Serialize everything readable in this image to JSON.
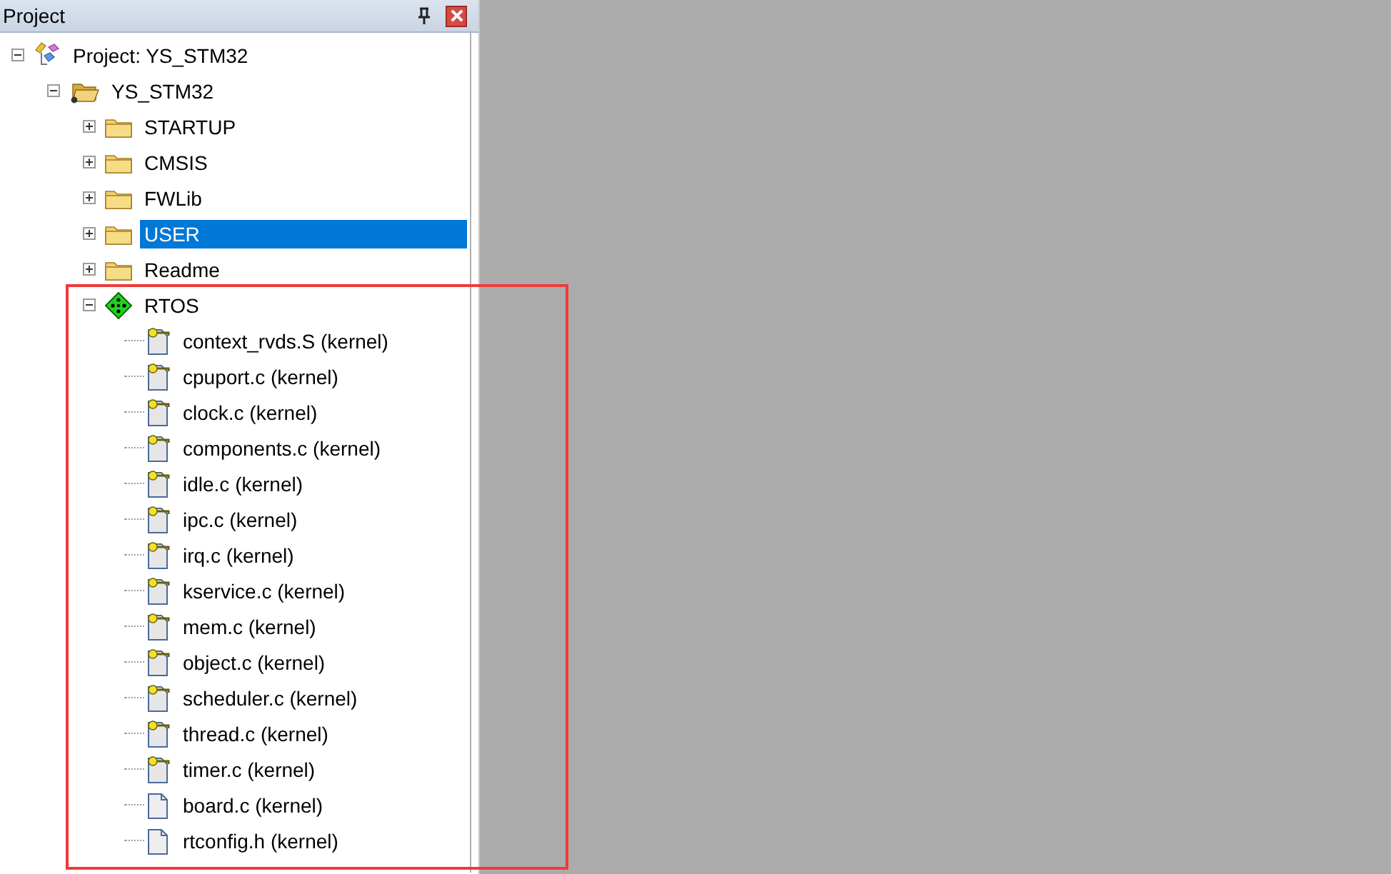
{
  "panel": {
    "title": "Project"
  },
  "tree": [
    {
      "kind": "project",
      "label": "Project: YS_STM32",
      "expanded": true,
      "selected": false,
      "children": [
        {
          "kind": "target",
          "label": "YS_STM32",
          "expanded": true,
          "selected": false,
          "children": [
            {
              "kind": "folder",
              "label": "STARTUP",
              "expanded": false,
              "selected": false,
              "highlighted": false
            },
            {
              "kind": "folder",
              "label": "CMSIS",
              "expanded": false,
              "selected": false,
              "highlighted": false
            },
            {
              "kind": "folder",
              "label": "FWLib",
              "expanded": false,
              "selected": false,
              "highlighted": false
            },
            {
              "kind": "folder",
              "label": "USER",
              "expanded": false,
              "selected": true,
              "highlighted": false
            },
            {
              "kind": "folder",
              "label": "Readme",
              "expanded": false,
              "selected": false,
              "highlighted": false
            },
            {
              "kind": "group",
              "label": "RTOS",
              "expanded": true,
              "selected": false,
              "highlighted": true,
              "children": [
                {
                  "kind": "file",
                  "label": "context_rvds.S (kernel)",
                  "locked": true,
                  "selected": false
                },
                {
                  "kind": "file",
                  "label": "cpuport.c (kernel)",
                  "locked": true,
                  "selected": false
                },
                {
                  "kind": "file",
                  "label": "clock.c (kernel)",
                  "locked": true,
                  "selected": false
                },
                {
                  "kind": "file",
                  "label": "components.c (kernel)",
                  "locked": true,
                  "selected": false
                },
                {
                  "kind": "file",
                  "label": "idle.c (kernel)",
                  "locked": true,
                  "selected": false
                },
                {
                  "kind": "file",
                  "label": "ipc.c (kernel)",
                  "locked": true,
                  "selected": false
                },
                {
                  "kind": "file",
                  "label": "irq.c (kernel)",
                  "locked": true,
                  "selected": false
                },
                {
                  "kind": "file",
                  "label": "kservice.c (kernel)",
                  "locked": true,
                  "selected": false
                },
                {
                  "kind": "file",
                  "label": "mem.c (kernel)",
                  "locked": true,
                  "selected": false
                },
                {
                  "kind": "file",
                  "label": "object.c (kernel)",
                  "locked": true,
                  "selected": false
                },
                {
                  "kind": "file",
                  "label": "scheduler.c (kernel)",
                  "locked": true,
                  "selected": false
                },
                {
                  "kind": "file",
                  "label": "thread.c (kernel)",
                  "locked": true,
                  "selected": false
                },
                {
                  "kind": "file",
                  "label": "timer.c (kernel)",
                  "locked": true,
                  "selected": false
                },
                {
                  "kind": "file",
                  "label": "board.c (kernel)",
                  "locked": false,
                  "selected": false
                },
                {
                  "kind": "file",
                  "label": "rtconfig.h (kernel)",
                  "locked": false,
                  "selected": false
                }
              ]
            }
          ]
        }
      ]
    }
  ]
}
